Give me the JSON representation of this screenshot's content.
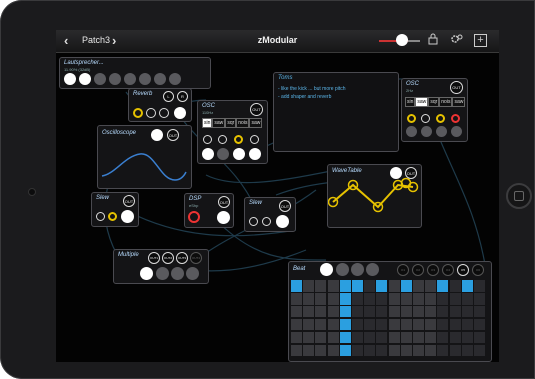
{
  "app": {
    "title": "zModular",
    "patch_name": "Patch3",
    "chevron_left": "‹",
    "chevron_right": "›",
    "volume_level": 0.5,
    "topbar_icons": [
      "lock-icon",
      "settings-icon",
      "add-icon"
    ]
  },
  "modules": {
    "loudspeaker": {
      "title": "Lautsprecher...",
      "subtitle": "11.90% (32dB)"
    },
    "reverb": {
      "title": "Reverb",
      "ports": [
        "L",
        "R"
      ]
    },
    "osc1": {
      "title": "OSC",
      "subtitle": "110Hz",
      "out": "OUT",
      "waves": [
        "sin",
        "saw",
        "sqr",
        "nois",
        "saw"
      ],
      "selected": 0
    },
    "oscilloscope": {
      "title": "Oscilloscope",
      "out": "OUT"
    },
    "toms": {
      "title": "Toms",
      "notes": [
        "- like the kick ... but more pitch",
        "- add shaper and reverb"
      ]
    },
    "osc2": {
      "title": "OSC",
      "subtitle": "2Hz",
      "out": "OUT",
      "waves": [
        "sin",
        "saw",
        "sqr",
        "nois",
        "saw"
      ],
      "selected": 1
    },
    "slew1": {
      "title": "Slew",
      "out": "OUT"
    },
    "dsp": {
      "title": "DSP",
      "subtitle": "eShp",
      "out": "OUT"
    },
    "slew2": {
      "title": "Slew",
      "out": "OUT"
    },
    "wavetable": {
      "title": "WaveTable",
      "out": "OUT"
    },
    "multiple": {
      "title": "Multiple",
      "outs": [
        "OUT1",
        "OUT2",
        "OUT3",
        "OUT4"
      ]
    },
    "beat": {
      "title": "Beat",
      "outs": [
        "O1",
        "O2",
        "O3",
        "O4",
        "O5",
        "O6"
      ]
    }
  },
  "colors": {
    "accent": "#5bb5e8",
    "grid_active": "#2b9fe0",
    "cable": "#1e3a4a",
    "wavetable": "#e6c200"
  }
}
